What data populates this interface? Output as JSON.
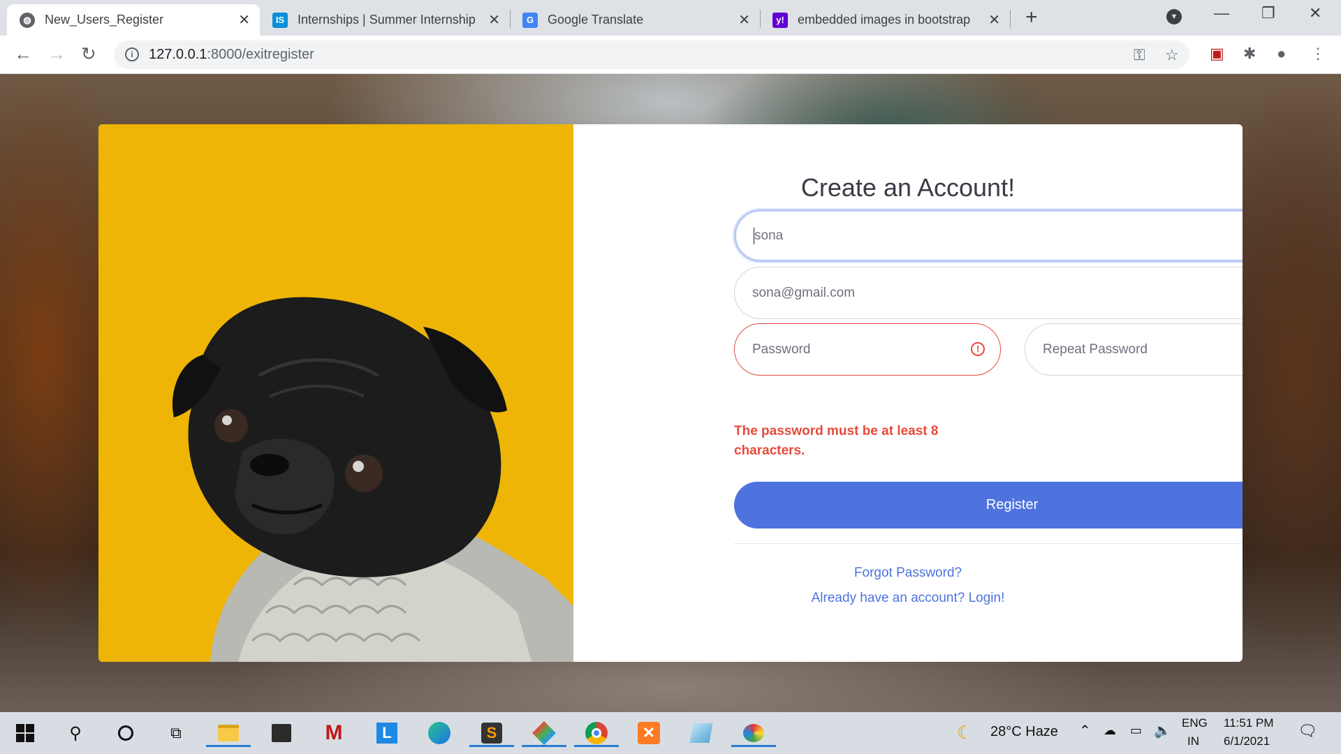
{
  "browser": {
    "tabs": [
      {
        "title": "New_Users_Register",
        "active": true,
        "icon": "globe-icon"
      },
      {
        "title": "Internships | Summer Internship",
        "active": false,
        "icon": "internshala-icon"
      },
      {
        "title": "Google Translate",
        "active": false,
        "icon": "google-translate-icon"
      },
      {
        "title": "embedded images in bootstrap",
        "active": false,
        "icon": "yahoo-icon"
      }
    ],
    "url_host": "127.0.0.1",
    "url_path": ":8000/exitregister"
  },
  "form": {
    "title": "Create an Account!",
    "name_value": "sona",
    "email_value": "sona@gmail.com",
    "password_placeholder": "Password",
    "repeat_password_placeholder": "Repeat Password",
    "error_message": "The password must be at least 8 characters.",
    "register_label": "Register",
    "forgot_link": "Forgot Password?",
    "login_link": "Already have an account? Login!"
  },
  "colors": {
    "primary": "#4e73df",
    "error": "#e74a3b",
    "image_bg": "#eeb506"
  },
  "taskbar": {
    "weather": "28°C  Haze",
    "lang_top": "ENG",
    "lang_bottom": "IN",
    "time": "11:51 PM",
    "date": "6/1/2021"
  }
}
